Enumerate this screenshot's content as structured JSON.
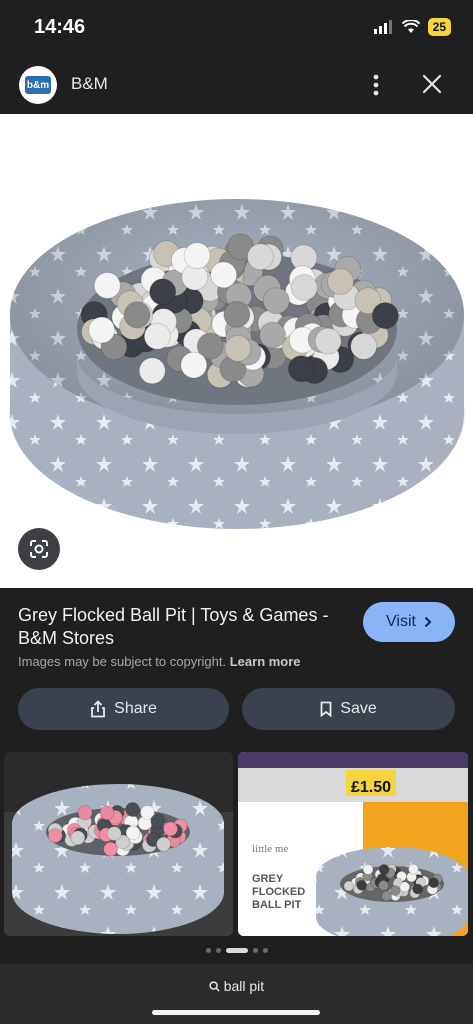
{
  "status_bar": {
    "time": "14:46",
    "battery": "25"
  },
  "app_bar": {
    "logo_text": "b&m",
    "site_name": "B&M"
  },
  "result": {
    "title": "Grey Flocked Ball Pit | Toys & Games - B&M Stores",
    "visit_label": "Visit",
    "copyright_text": "Images may be subject to copyright.",
    "learn_more": "Learn more",
    "share_label": "Share",
    "save_label": "Save"
  },
  "related": {
    "thumb2_price": "£1.50",
    "thumb2_brand": "little me",
    "thumb2_product": [
      "GREY",
      "FLOCKED",
      "BALL PIT"
    ]
  },
  "search": {
    "query": "ball pit"
  },
  "colors": {
    "accent": "#8ab4f8",
    "battery": "#f5d53b"
  }
}
